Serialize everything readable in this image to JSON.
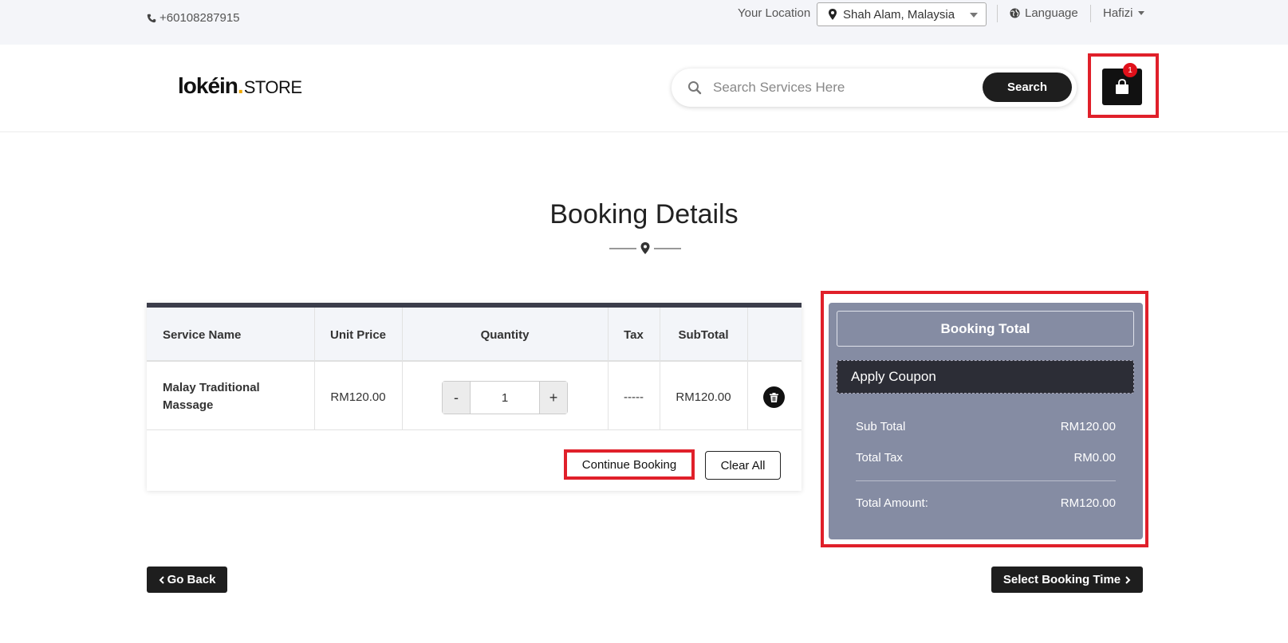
{
  "topbar": {
    "phone": "+60108287915",
    "location_label": "Your Location",
    "location_value": "Shah Alam, Malaysia",
    "language": "Language",
    "user": "Hafizi"
  },
  "header": {
    "logo_brand": "lokéin",
    "logo_dot": ".",
    "logo_store": "STORE",
    "search_placeholder": "Search Services Here",
    "search_button": "Search",
    "cart_count": "1"
  },
  "page_title": "Booking Details",
  "table": {
    "columns": [
      "Service Name",
      "Unit Price",
      "Quantity",
      "Tax",
      "SubTotal"
    ],
    "rows": [
      {
        "service_name": "Malay Traditional Massage",
        "unit_price": "RM120.00",
        "quantity": "1",
        "tax": "-----",
        "subtotal": "RM120.00"
      }
    ],
    "qty_minus": "-",
    "qty_plus": "+",
    "continue_button": "Continue Booking",
    "clear_button": "Clear All"
  },
  "booking_total": {
    "title": "Booking Total",
    "coupon": "Apply Coupon",
    "sub_total_label": "Sub Total",
    "sub_total_value": "RM120.00",
    "total_tax_label": "Total Tax",
    "total_tax_value": "RM0.00",
    "total_amount_label": "Total Amount:",
    "total_amount_value": "RM120.00"
  },
  "nav": {
    "back": "Go Back",
    "next": "Select Booking Time"
  },
  "colors": {
    "highlight": "#e0202a",
    "panel": "#858ca3",
    "dark": "#1e1e1e",
    "accent_dot": "#f0a800"
  }
}
